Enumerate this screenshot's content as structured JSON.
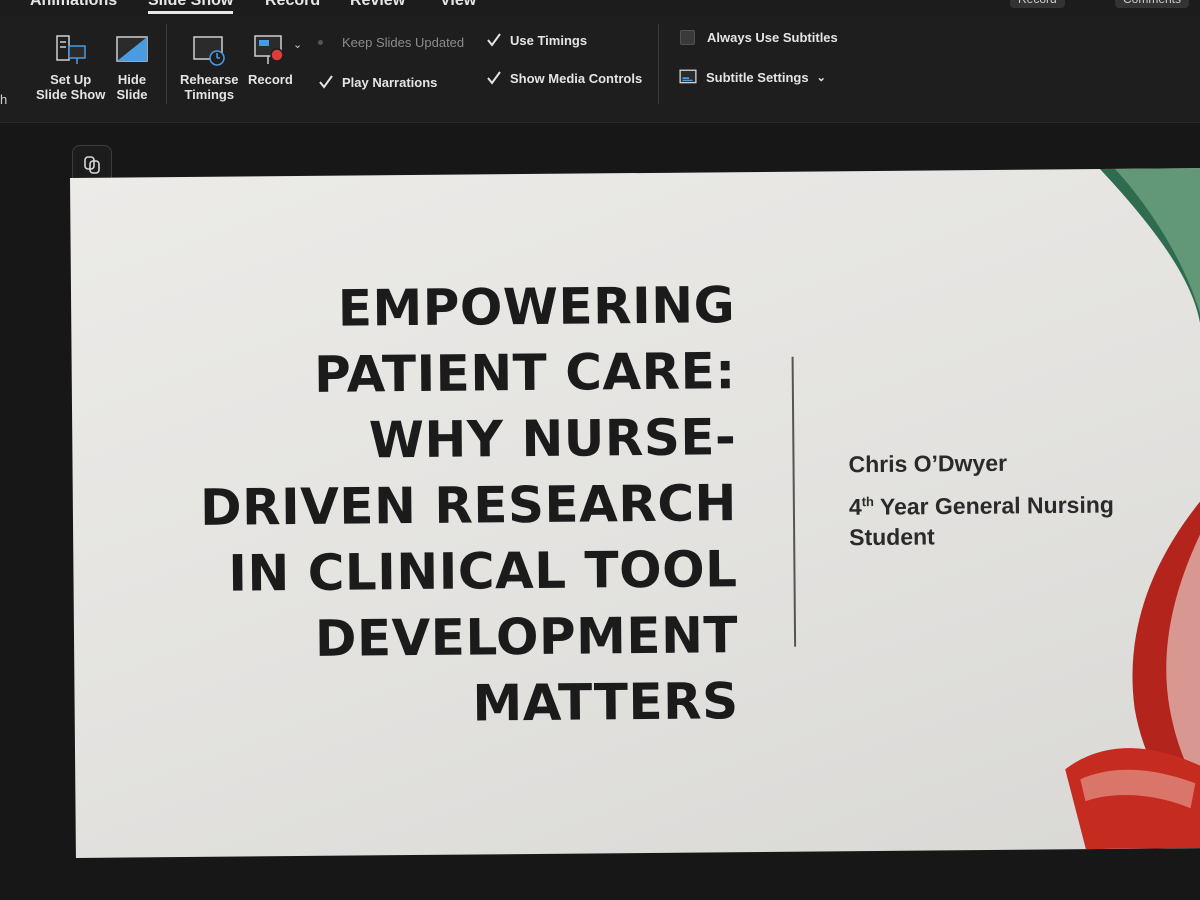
{
  "tabs": [
    {
      "label": "Animations",
      "active": false
    },
    {
      "label": "Slide Show",
      "active": true
    },
    {
      "label": "Record",
      "active": false
    },
    {
      "label": "Review",
      "active": false
    },
    {
      "label": "View",
      "active": false
    }
  ],
  "tab_right": {
    "record_label": "Record",
    "comments_label": "Comments"
  },
  "ribbon": {
    "left_edge_label": "h",
    "setup_line1": "Set Up",
    "setup_line2": "Slide Show",
    "hide_line1": "Hide",
    "hide_line2": "Slide",
    "rehearse_line1": "Rehearse",
    "rehearse_line2": "Timings",
    "record_label": "Record",
    "keep_updated": "Keep Slides Updated",
    "use_timings": "Use Timings",
    "play_narrations": "Play Narrations",
    "show_media_controls": "Show Media Controls",
    "always_subtitles": "Always Use Subtitles",
    "subtitle_settings": "Subtitle Settings"
  },
  "slide": {
    "title": "EMPOWERING\nPATIENT CARE:\nWHY NURSE-\nDRIVEN RESEARCH\nIN CLINICAL TOOL\nDEVELOPMENT\nMATTERS",
    "author": "Chris O’Dwyer",
    "role_number": "4",
    "role_suffix": "th",
    "role_rest": " Year General Nursing Student"
  },
  "colors": {
    "ribbon_bg": "#1e1e1e",
    "workspace_bg": "#171717",
    "slide_bg": "#e8e7e4",
    "accent_blue": "#4a9be0",
    "record_red": "#e03a3a"
  }
}
